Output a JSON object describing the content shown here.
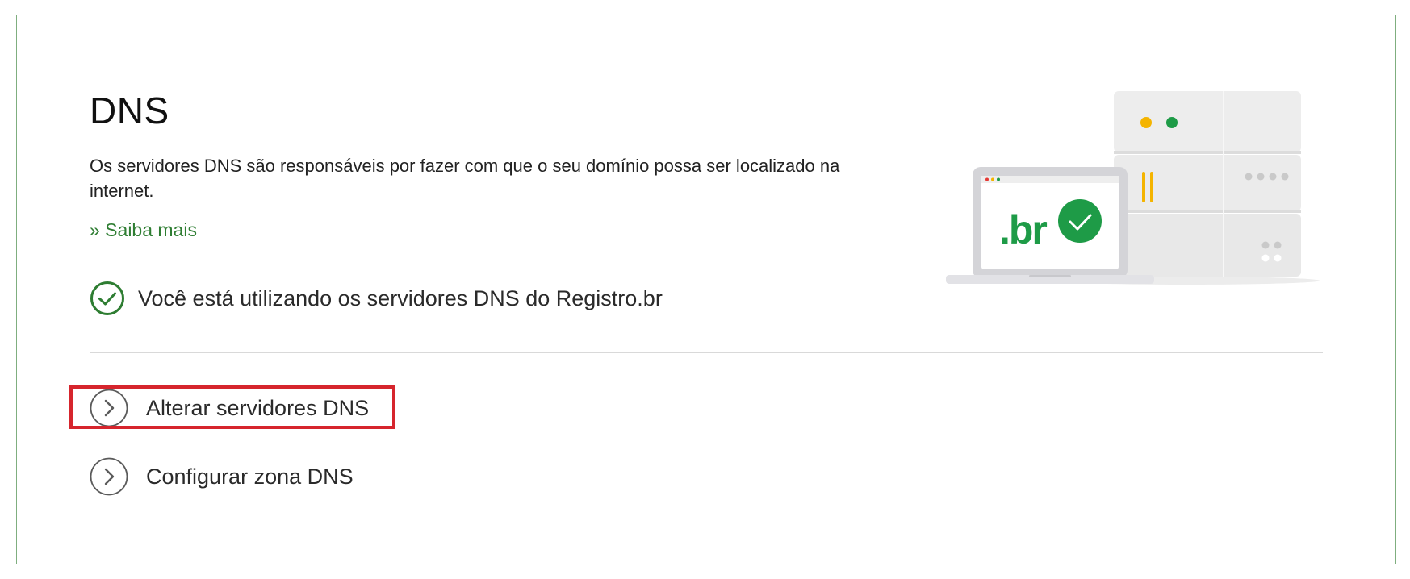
{
  "section": {
    "title": "DNS",
    "description": "Os servidores DNS são responsáveis por fazer com que o seu domínio possa ser localizado na internet.",
    "learn_more": "» Saiba mais"
  },
  "status": {
    "text": "Você está utilizando os servidores DNS do Registro.br",
    "icon": "check-circle-icon",
    "color": "#2e7d32"
  },
  "actions": [
    {
      "label": "Alterar servidores DNS",
      "icon": "chevron-right-icon",
      "highlighted": true
    },
    {
      "label": "Configurar zona DNS",
      "icon": "chevron-right-icon",
      "highlighted": false
    }
  ],
  "illustration": {
    "logo_text": ".br",
    "icon": "server-laptop-illustration"
  },
  "colors": {
    "accent": "#2e7d32",
    "highlight": "#d6252d",
    "border": "#7fae7f"
  }
}
